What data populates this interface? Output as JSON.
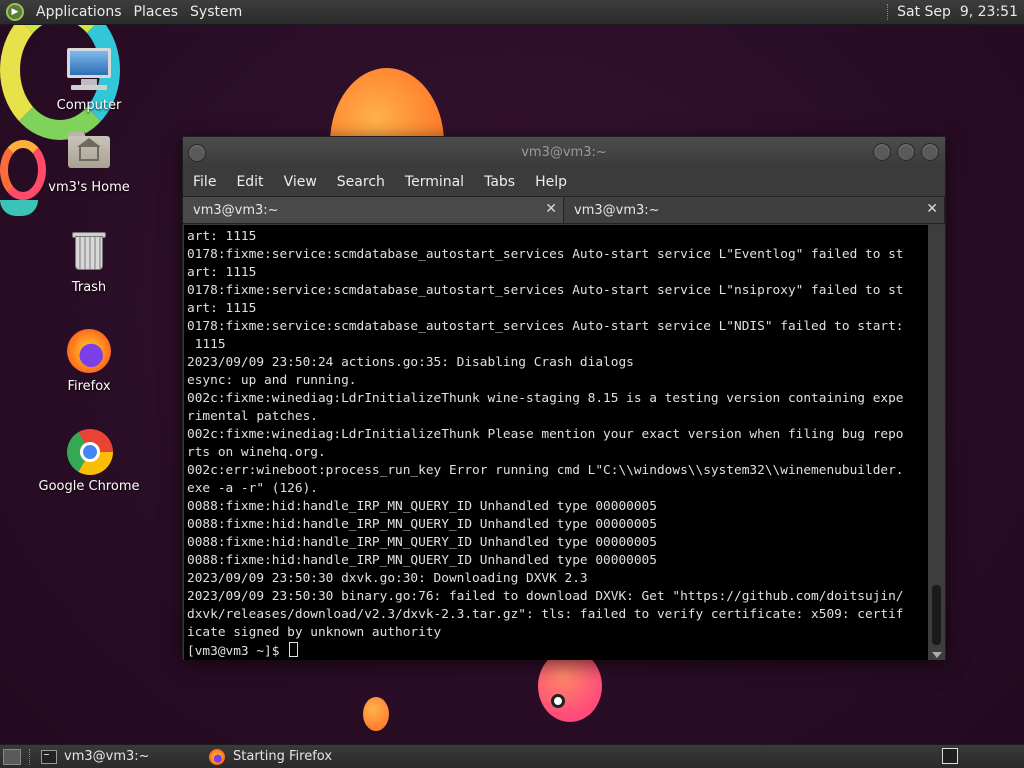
{
  "top_panel": {
    "menus": [
      "Applications",
      "Places",
      "System"
    ],
    "clock": "Sat Sep  9, 23:51"
  },
  "desktop_icons": [
    {
      "label": "Computer",
      "icon": "computer-icon"
    },
    {
      "label": "vm3's Home",
      "icon": "home-folder-icon"
    },
    {
      "label": "Trash",
      "icon": "trash-icon"
    },
    {
      "label": "Firefox",
      "icon": "firefox-icon"
    },
    {
      "label": "Google Chrome",
      "icon": "chrome-icon"
    }
  ],
  "terminal": {
    "title": "vm3@vm3:~",
    "menu": [
      "File",
      "Edit",
      "View",
      "Search",
      "Terminal",
      "Tabs",
      "Help"
    ],
    "tabs": [
      {
        "label": "vm3@vm3:~"
      },
      {
        "label": "vm3@vm3:~"
      }
    ],
    "lines": [
      "art: 1115",
      "0178:fixme:service:scmdatabase_autostart_services Auto-start service L\"Eventlog\" failed to st",
      "art: 1115",
      "0178:fixme:service:scmdatabase_autostart_services Auto-start service L\"nsiproxy\" failed to st",
      "art: 1115",
      "0178:fixme:service:scmdatabase_autostart_services Auto-start service L\"NDIS\" failed to start:",
      " 1115",
      "2023/09/09 23:50:24 actions.go:35: Disabling Crash dialogs",
      "esync: up and running.",
      "002c:fixme:winediag:LdrInitializeThunk wine-staging 8.15 is a testing version containing expe",
      "rimental patches.",
      "002c:fixme:winediag:LdrInitializeThunk Please mention your exact version when filing bug repo",
      "rts on winehq.org.",
      "002c:err:wineboot:process_run_key Error running cmd L\"C:\\\\windows\\\\system32\\\\winemenubuilder.",
      "exe -a -r\" (126).",
      "0088:fixme:hid:handle_IRP_MN_QUERY_ID Unhandled type 00000005",
      "0088:fixme:hid:handle_IRP_MN_QUERY_ID Unhandled type 00000005",
      "0088:fixme:hid:handle_IRP_MN_QUERY_ID Unhandled type 00000005",
      "0088:fixme:hid:handle_IRP_MN_QUERY_ID Unhandled type 00000005",
      "2023/09/09 23:50:30 dxvk.go:30: Downloading DXVK 2.3",
      "2023/09/09 23:50:30 binary.go:76: failed to download DXVK: Get \"https://github.com/doitsujin/",
      "dxvk/releases/download/v2.3/dxvk-2.3.tar.gz\": tls: failed to verify certificate: x509: certif",
      "icate signed by unknown authority"
    ],
    "prompt": "[vm3@vm3 ~]$ "
  },
  "taskbar": {
    "items": [
      {
        "label": "vm3@vm3:~",
        "icon": "terminal-icon"
      },
      {
        "label": "Starting Firefox",
        "icon": "firefox-icon"
      }
    ]
  }
}
